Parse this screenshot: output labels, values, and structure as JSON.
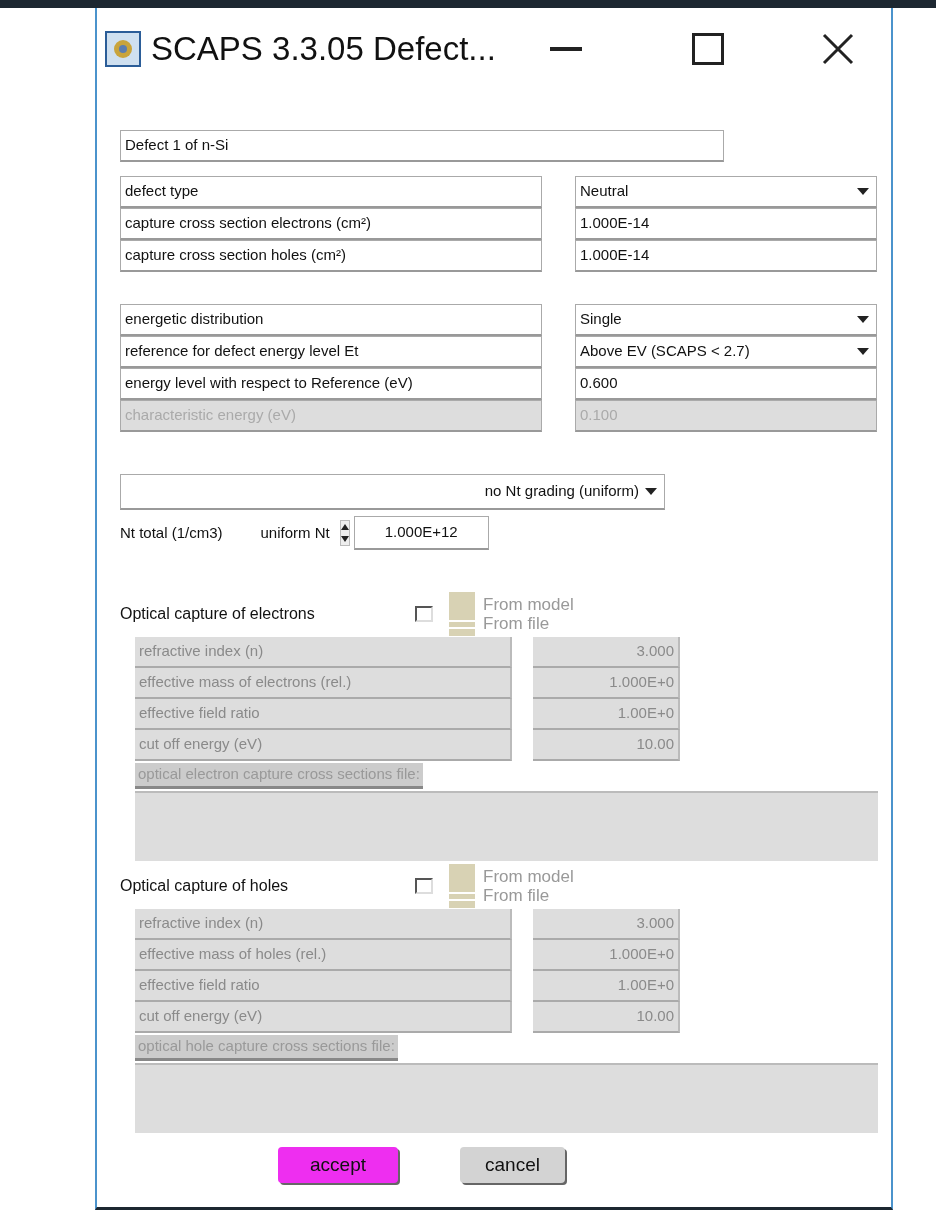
{
  "window": {
    "title": "SCAPS 3.3.05 Defect..."
  },
  "defect_name": "Defect 1 of n-Si",
  "parameter_groups": [
    [
      {
        "label": "defect type",
        "value": "Neutral",
        "kind": "dropdown",
        "disabled": false
      },
      {
        "label": "capture cross section electrons (cm²)",
        "value": "1.000E-14",
        "kind": "input",
        "disabled": false
      },
      {
        "label": "capture cross section holes (cm²)",
        "value": "1.000E-14",
        "kind": "input",
        "disabled": false
      }
    ],
    [
      {
        "label": "energetic distribution",
        "value": "Single",
        "kind": "dropdown",
        "disabled": false
      },
      {
        "label": "reference for defect energy level Et",
        "value": "Above EV (SCAPS < 2.7)",
        "kind": "dropdown",
        "disabled": false
      },
      {
        "label": "energy level with respect to Reference (eV)",
        "value": "0.600",
        "kind": "input",
        "disabled": false
      },
      {
        "label": "characteristic energy (eV)",
        "value": "0.100",
        "kind": "input",
        "disabled": true
      }
    ]
  ],
  "grading": {
    "value": "no Nt grading (uniform)"
  },
  "nt": {
    "label": "Nt total (1/cm3)",
    "mode_label": "uniform Nt",
    "value": "1.000E+12"
  },
  "optical": [
    {
      "title": "Optical capture of electrons",
      "checked": false,
      "disabled": true,
      "source_options": [
        "From model",
        "From file"
      ],
      "parameters": [
        {
          "label": "refractive index (n)",
          "value": "3.000"
        },
        {
          "label": "effective mass of electrons (rel.)",
          "value": "1.000E+0"
        },
        {
          "label": "effective field ratio",
          "value": "1.00E+0"
        },
        {
          "label": "cut off energy (eV)",
          "value": "10.00"
        }
      ],
      "file_label": "optical electron capture cross sections file:"
    },
    {
      "title": "Optical capture of holes",
      "checked": false,
      "disabled": true,
      "source_options": [
        "From model",
        "From file"
      ],
      "parameters": [
        {
          "label": "refractive index (n)",
          "value": "3.000"
        },
        {
          "label": "effective mass of holes (rel.)",
          "value": "1.000E+0"
        },
        {
          "label": "effective field ratio",
          "value": "1.00E+0"
        },
        {
          "label": "cut off energy (eV)",
          "value": "10.00"
        }
      ],
      "file_label": "optical hole capture cross sections file:"
    }
  ],
  "buttons": [
    {
      "label": "accept",
      "kind": "primary"
    },
    {
      "label": "cancel",
      "kind": "secondary"
    }
  ]
}
